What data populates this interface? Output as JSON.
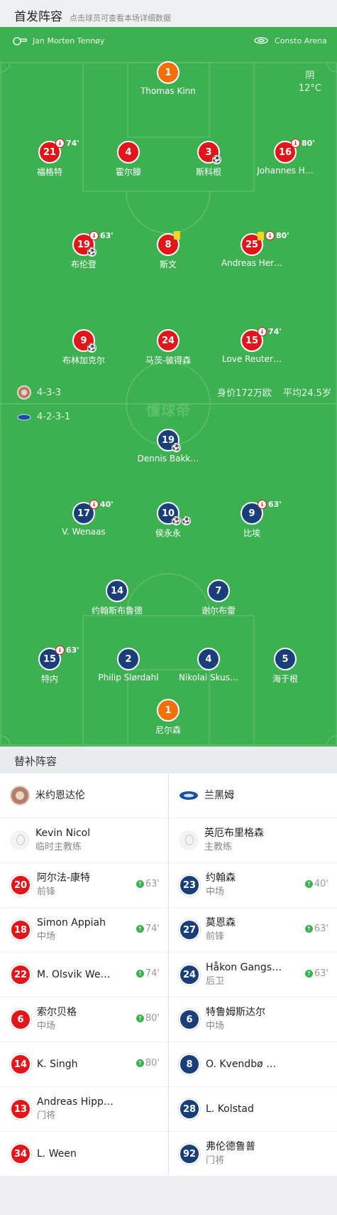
{
  "header": {
    "title": "首发阵容",
    "subtitle": "点击球员可查看本场详细数据"
  },
  "match": {
    "referee": "Jan Morten Tennøy",
    "venue": "Consto Arena",
    "weather": "阴",
    "temperature": "12°C"
  },
  "home": {
    "formation": "4-3-3",
    "value": "身价172万欧",
    "avg_age": "平均24.5岁"
  },
  "away": {
    "formation": "4-2-3-1"
  },
  "watermark": "懂球帝",
  "bench_title": "替补阵容",
  "bench": {
    "home_team": "米约恩达伦",
    "away_team": "兰黑姆",
    "rows": [
      {
        "l": {
          "name": "Kevin Nicol",
          "pos": "临时主教练"
        },
        "r": {
          "name": "英厄布里格森",
          "pos": "主教练"
        }
      },
      {
        "l": {
          "num": "20",
          "name": "阿尔法-康特",
          "pos": "前锋",
          "time": "63'"
        },
        "r": {
          "num": "23",
          "name": "约翰森",
          "pos": "中场",
          "time": "40'"
        }
      },
      {
        "l": {
          "num": "18",
          "name": "Simon Appiah",
          "pos": "中场",
          "time": "74'"
        },
        "r": {
          "num": "27",
          "name": "莫恩森",
          "pos": "前锋",
          "time": "63'"
        }
      },
      {
        "l": {
          "num": "22",
          "name": "M. Olsvik We…",
          "pos": "",
          "time": "74'"
        },
        "r": {
          "num": "24",
          "name": "Håkon Gangs…",
          "pos": "后卫",
          "time": "63'"
        }
      },
      {
        "l": {
          "num": "6",
          "name": "索尔贝格",
          "pos": "中场",
          "time": "80'"
        },
        "r": {
          "num": "6",
          "name": "特鲁姆斯达尔",
          "pos": "中场"
        }
      },
      {
        "l": {
          "num": "14",
          "name": "K. Singh",
          "pos": "",
          "time": "80'"
        },
        "r": {
          "num": "8",
          "name": "O. Kvendbø …",
          "pos": ""
        }
      },
      {
        "l": {
          "num": "13",
          "name": "Andreas Hipp…",
          "pos": "门将"
        },
        "r": {
          "num": "28",
          "name": "L. Kolstad",
          "pos": ""
        }
      },
      {
        "l": {
          "num": "34",
          "name": "L. Ween",
          "pos": ""
        },
        "r": {
          "num": "92",
          "name": "弗伦德鲁普",
          "pos": "门将"
        }
      }
    ]
  },
  "home_players": [
    {
      "num": "1",
      "name": "Thomas Kinn",
      "color": "o"
    },
    {
      "num": "21",
      "name": "福格特",
      "sub": "74'"
    },
    {
      "num": "4",
      "name": "霍尔滕"
    },
    {
      "num": "3",
      "name": "斯科根",
      "balls": 1
    },
    {
      "num": "16",
      "name": "Johannes H…",
      "sub": "80'"
    },
    {
      "num": "19",
      "name": "布伦登",
      "sub": "63'",
      "balls": 1
    },
    {
      "num": "8",
      "name": "斯文",
      "yellow": true
    },
    {
      "num": "25",
      "name": "Andreas Her…",
      "sub": "80'",
      "yellow": true
    },
    {
      "num": "9",
      "name": "布林加克尔",
      "balls": 1
    },
    {
      "num": "24",
      "name": "马茨-彼得森"
    },
    {
      "num": "15",
      "name": "Love Reuter…",
      "sub": "74'"
    }
  ],
  "away_players": [
    {
      "num": "19",
      "name": "Dennis Bakk…",
      "balls": 1
    },
    {
      "num": "17",
      "name": "V. Wenaas",
      "sub": "40'"
    },
    {
      "num": "10",
      "name": "侯永永",
      "balls": 2
    },
    {
      "num": "9",
      "name": "比埃",
      "sub": "63'"
    },
    {
      "num": "14",
      "name": "约翰斯布鲁德"
    },
    {
      "num": "7",
      "name": "谢尔布雷"
    },
    {
      "num": "15",
      "name": "特内",
      "sub": "63'"
    },
    {
      "num": "2",
      "name": "Philip Slørdahl"
    },
    {
      "num": "4",
      "name": "Nikolai Skus…"
    },
    {
      "num": "5",
      "name": "海于根"
    },
    {
      "num": "1",
      "name": "尼尔森",
      "color": "o"
    }
  ],
  "colors": {
    "pitch": "#3db051",
    "home": "#e1161a",
    "away": "#1a3e78",
    "keeper": "#f26f0c"
  }
}
